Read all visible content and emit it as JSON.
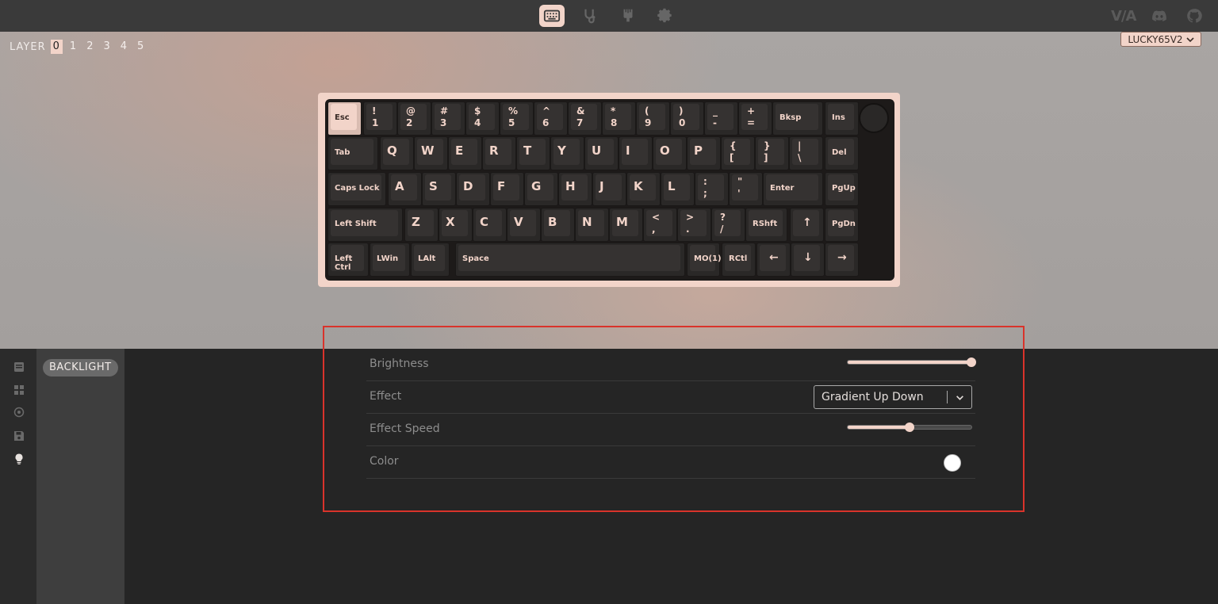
{
  "app": {
    "logo": "V/A"
  },
  "layer_bar": {
    "label": "LAYER",
    "layers": [
      "0",
      "1",
      "2",
      "3",
      "4",
      "5"
    ],
    "active_layer": "0"
  },
  "device": {
    "name": "LUCKY65V2"
  },
  "keyboard": {
    "rows": [
      [
        {
          "k": "esc",
          "label": "Esc"
        },
        {
          "k": "1",
          "top": "!",
          "bot": "1"
        },
        {
          "k": "2",
          "top": "@",
          "bot": "2"
        },
        {
          "k": "3",
          "top": "#",
          "bot": "3"
        },
        {
          "k": "4",
          "top": "$",
          "bot": "4"
        },
        {
          "k": "5",
          "top": "%",
          "bot": "5"
        },
        {
          "k": "6",
          "top": "^",
          "bot": "6"
        },
        {
          "k": "7",
          "top": "&",
          "bot": "7"
        },
        {
          "k": "8",
          "top": "*",
          "bot": "8"
        },
        {
          "k": "9",
          "top": "(",
          "bot": "9"
        },
        {
          "k": "0",
          "top": ")",
          "bot": "0"
        },
        {
          "k": "minus",
          "top": "_",
          "bot": "-"
        },
        {
          "k": "equal",
          "top": "+",
          "bot": "="
        },
        {
          "k": "bksp",
          "label": "Bksp"
        },
        {
          "k": "ins",
          "label": "Ins"
        }
      ],
      [
        {
          "k": "tab",
          "label": "Tab"
        },
        {
          "k": "q",
          "big": "Q"
        },
        {
          "k": "w",
          "big": "W"
        },
        {
          "k": "e",
          "big": "E"
        },
        {
          "k": "r",
          "big": "R"
        },
        {
          "k": "t",
          "big": "T"
        },
        {
          "k": "y",
          "big": "Y"
        },
        {
          "k": "u",
          "big": "U"
        },
        {
          "k": "i",
          "big": "I"
        },
        {
          "k": "o",
          "big": "O"
        },
        {
          "k": "p",
          "big": "P"
        },
        {
          "k": "lbracket",
          "top": "{",
          "bot": "["
        },
        {
          "k": "rbracket",
          "top": "}",
          "bot": "]"
        },
        {
          "k": "backslash",
          "top": "|",
          "bot": "\\"
        },
        {
          "k": "del",
          "label": "Del"
        }
      ],
      [
        {
          "k": "caps",
          "label": "Caps Lock"
        },
        {
          "k": "a",
          "big": "A"
        },
        {
          "k": "s",
          "big": "S"
        },
        {
          "k": "d",
          "big": "D"
        },
        {
          "k": "f",
          "big": "F"
        },
        {
          "k": "g",
          "big": "G"
        },
        {
          "k": "h",
          "big": "H"
        },
        {
          "k": "j",
          "big": "J"
        },
        {
          "k": "k",
          "big": "K"
        },
        {
          "k": "l",
          "big": "L"
        },
        {
          "k": "semicolon",
          "top": ":",
          "bot": ";"
        },
        {
          "k": "quote",
          "top": "\"",
          "bot": "'"
        },
        {
          "k": "enter",
          "label": "Enter"
        },
        {
          "k": "pgup",
          "label": "PgUp"
        }
      ],
      [
        {
          "k": "lshift",
          "label": "Left Shift"
        },
        {
          "k": "z",
          "big": "Z"
        },
        {
          "k": "x",
          "big": "X"
        },
        {
          "k": "c",
          "big": "C"
        },
        {
          "k": "v",
          "big": "V"
        },
        {
          "k": "b",
          "big": "B"
        },
        {
          "k": "n",
          "big": "N"
        },
        {
          "k": "m",
          "big": "M"
        },
        {
          "k": "comma",
          "top": "<",
          "bot": ","
        },
        {
          "k": "period",
          "top": ">",
          "bot": "."
        },
        {
          "k": "slash",
          "top": "?",
          "bot": "/"
        },
        {
          "k": "rshift",
          "label": "RShft"
        },
        {
          "k": "up",
          "label": "↑"
        },
        {
          "k": "pgdn",
          "label": "PgDn"
        }
      ],
      [
        {
          "k": "lctrl",
          "label": "Left Ctrl"
        },
        {
          "k": "lwin",
          "label": "LWin"
        },
        {
          "k": "lalt",
          "label": "LAlt"
        },
        {
          "k": "space",
          "label": "Space"
        },
        {
          "k": "mo1",
          "label": "MO(1)"
        },
        {
          "k": "rctl",
          "label": "RCtl"
        },
        {
          "k": "left",
          "label": "←"
        },
        {
          "k": "down",
          "label": "↓"
        },
        {
          "k": "right",
          "label": "→"
        }
      ]
    ]
  },
  "sidebar": {
    "icons": [
      "keymap-icon",
      "macros-icon",
      "layouts-icon",
      "save-load-icon",
      "lighting-icon"
    ]
  },
  "menu": {
    "active_tab": "BACKLIGHT"
  },
  "settings": {
    "brightness": {
      "label": "Brightness",
      "value_fraction": 1.0
    },
    "effect": {
      "label": "Effect",
      "value": "Gradient Up Down"
    },
    "effect_speed": {
      "label": "Effect Speed",
      "value_fraction": 0.5
    },
    "color": {
      "label": "Color",
      "value": "#ffffff"
    }
  },
  "colors": {
    "accent": "#f2d4c9",
    "topbar": "#3a3a3a",
    "panel": "#252525",
    "highlight": "#d9332b"
  }
}
